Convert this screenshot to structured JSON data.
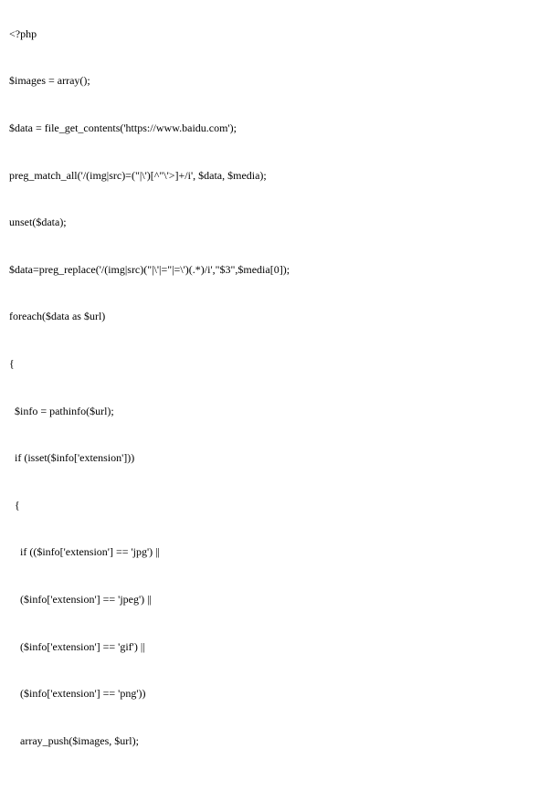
{
  "code": {
    "lines": [
      "<?php",
      "$images = array();",
      "$data = file_get_contents('https://www.baidu.com');",
      "preg_match_all('/(img|src)=(\"|\\')[^\"\\'>]+/i', $data, $media);",
      "unset($data);",
      "$data=preg_replace('/(img|src)(\"|\\'|=\"|=\\')(.*)/i',\"$3\",$media[0]);",
      "foreach($data as $url)",
      "{",
      "  $info = pathinfo($url);",
      "  if (isset($info['extension']))",
      "  {",
      "    if (($info['extension'] == 'jpg') ||",
      "    ($info['extension'] == 'jpeg') ||",
      "    ($info['extension'] == 'gif') ||",
      "    ($info['extension'] == 'png'))",
      "    array_push($images, $url);"
    ]
  }
}
